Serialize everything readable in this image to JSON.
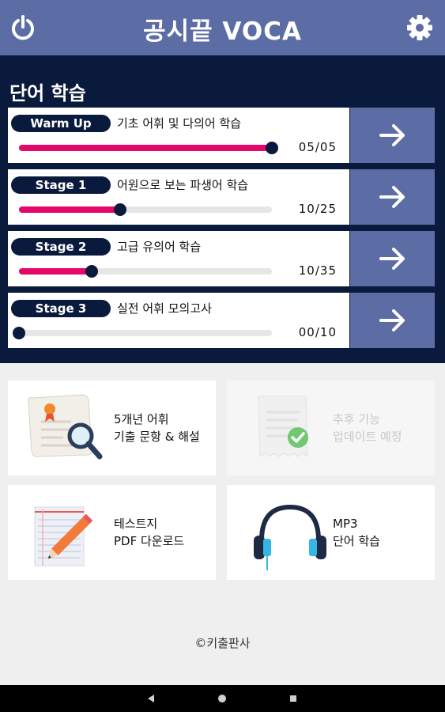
{
  "header": {
    "title": "공시끝 VOCA",
    "power_icon": "power-icon",
    "settings_icon": "gear-icon",
    "bg_color": "#5c6ca4"
  },
  "study": {
    "title": "단어 학습",
    "bg_color": "#0a1a3c",
    "progress_color": "#e3086a",
    "rows": [
      {
        "stage": "Warm Up",
        "desc": "기초 어휘 및 다의어 학습",
        "count": "05/05",
        "progress": 1.0
      },
      {
        "stage": "Stage 1",
        "desc": "어원으로 보는 파생어 학습",
        "count": "10/25",
        "progress": 0.4
      },
      {
        "stage": "Stage 2",
        "desc": "고급 유의어 학습",
        "count": "10/35",
        "progress": 0.286
      },
      {
        "stage": "Stage 3",
        "desc": "실전 어휘 모의고사",
        "count": "00/10",
        "progress": 0.0
      }
    ]
  },
  "menu": [
    {
      "line1": "5개년 어휘",
      "line2": "기출 문항 & 해설",
      "icon": "document-magnifier-icon",
      "enabled": true
    },
    {
      "line1": "추후 기능",
      "line2": "업데이트 예정",
      "icon": "receipt-check-icon",
      "enabled": false
    },
    {
      "line1": "테스트지",
      "line2": "PDF 다운로드",
      "icon": "notepad-pencil-icon",
      "enabled": true
    },
    {
      "line1": "MP3",
      "line2": "단어 학습",
      "icon": "headphones-icon",
      "enabled": true
    }
  ],
  "footer": {
    "copyright": "©키출판사"
  },
  "navbar": {
    "back": "back-icon",
    "home": "home-icon",
    "recents": "recents-icon"
  }
}
